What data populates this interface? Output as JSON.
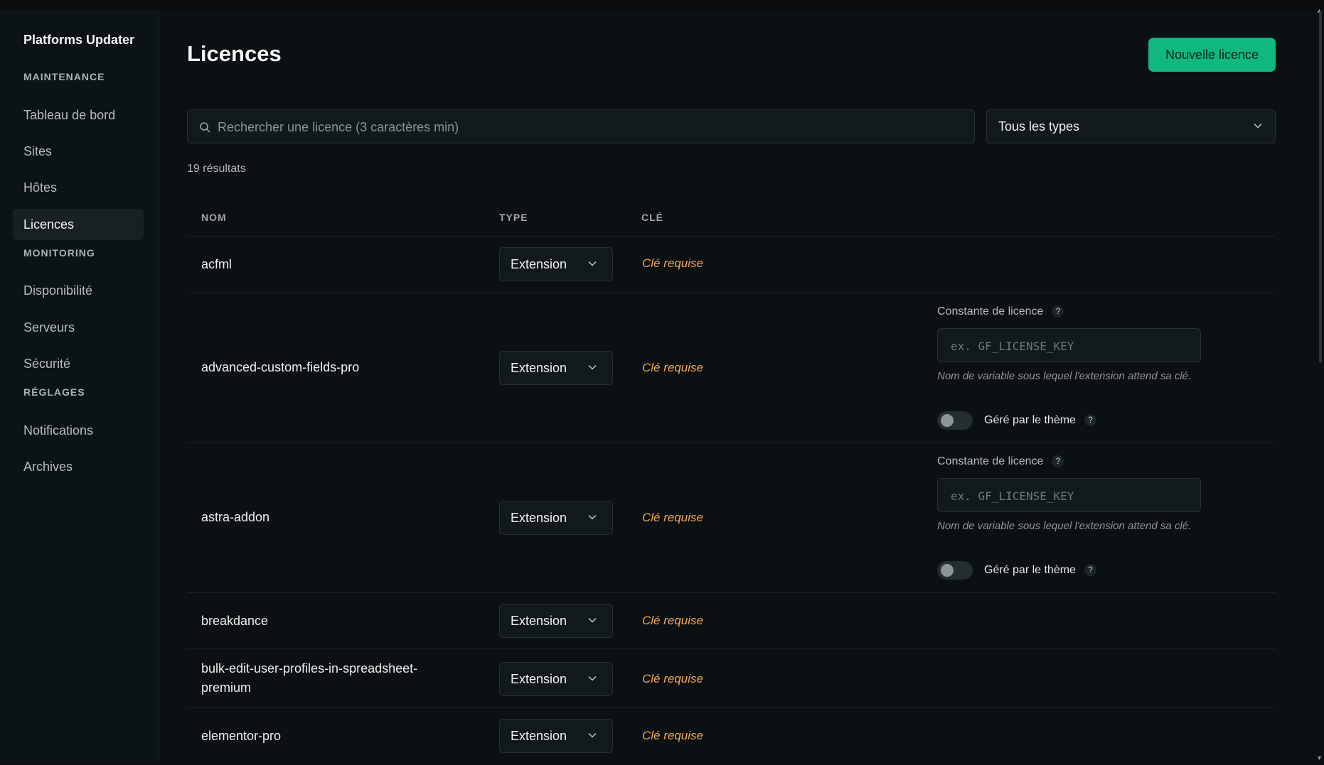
{
  "app": {
    "name": "Platforms Updater"
  },
  "sidebar": {
    "sections": [
      {
        "title": "MAINTENANCE",
        "items": [
          "Tableau de bord",
          "Sites",
          "Hôtes",
          "Licences"
        ]
      },
      {
        "title": "MONITORING",
        "items": [
          "Disponibilité",
          "Serveurs",
          "Sécurité"
        ]
      },
      {
        "title": "RÉGLAGES",
        "items": [
          "Notifications",
          "Archives"
        ]
      }
    ],
    "active_item": "Licences"
  },
  "page": {
    "title": "Licences",
    "new_button": "Nouvelle licence",
    "search_placeholder": "Rechercher une licence (3 caractères min)",
    "type_filter": "Tous les types",
    "result_count": "19 résultats"
  },
  "table": {
    "headers": {
      "name": "NOM",
      "type": "TYPE",
      "key": "CLÉ"
    },
    "rows": [
      {
        "name": "acfml",
        "type": "Extension",
        "key_status": "Clé requise"
      },
      {
        "name": "advanced-custom-fields-pro",
        "type": "Extension",
        "key_status": "Clé requise",
        "constant_label": "Constante de licence",
        "constant_placeholder": "ex. GF_LICENSE_KEY",
        "hint": "Nom de variable sous lequel l'extension attend sa clé.",
        "toggle_label": "Géré par le thème",
        "toggle_on": false
      },
      {
        "name": "astra-addon",
        "type": "Extension",
        "key_status": "Clé requise",
        "constant_label": "Constante de licence",
        "constant_placeholder": "ex. GF_LICENSE_KEY",
        "hint": "Nom de variable sous lequel l'extension attend sa clé.",
        "toggle_label": "Géré par le thème",
        "toggle_on": false
      },
      {
        "name": "breakdance",
        "type": "Extension",
        "key_status": "Clé requise"
      },
      {
        "name": "bulk-edit-user-profiles-in-spreadsheet-premium",
        "type": "Extension",
        "key_status": "Clé requise"
      },
      {
        "name": "elementor-pro",
        "type": "Extension",
        "key_status": "Clé requise"
      }
    ]
  },
  "help_glyph": "?",
  "colors": {
    "accent": "#10b77f",
    "warning": "#f2a65a",
    "background": "#0b1012"
  }
}
